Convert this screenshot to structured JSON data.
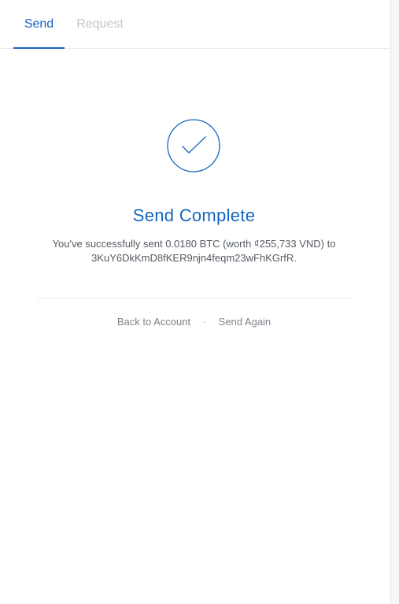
{
  "tabs": {
    "send": "Send",
    "request": "Request"
  },
  "status": {
    "icon": "checkmark-icon",
    "title": "Send Complete",
    "message_line1": "You've successfully sent 0.0180 BTC (worth ₫255,733 VND) to",
    "message_line2": "3KuY6DkKmD8fKER9njn4feqm23wFhKGrfR."
  },
  "actions": {
    "back_label": "Back to Account",
    "separator": "·",
    "send_again_label": "Send Again"
  },
  "colors": {
    "accent": "#1565c0",
    "muted_tab": "#c2c6cc",
    "body_text": "#555b62"
  }
}
